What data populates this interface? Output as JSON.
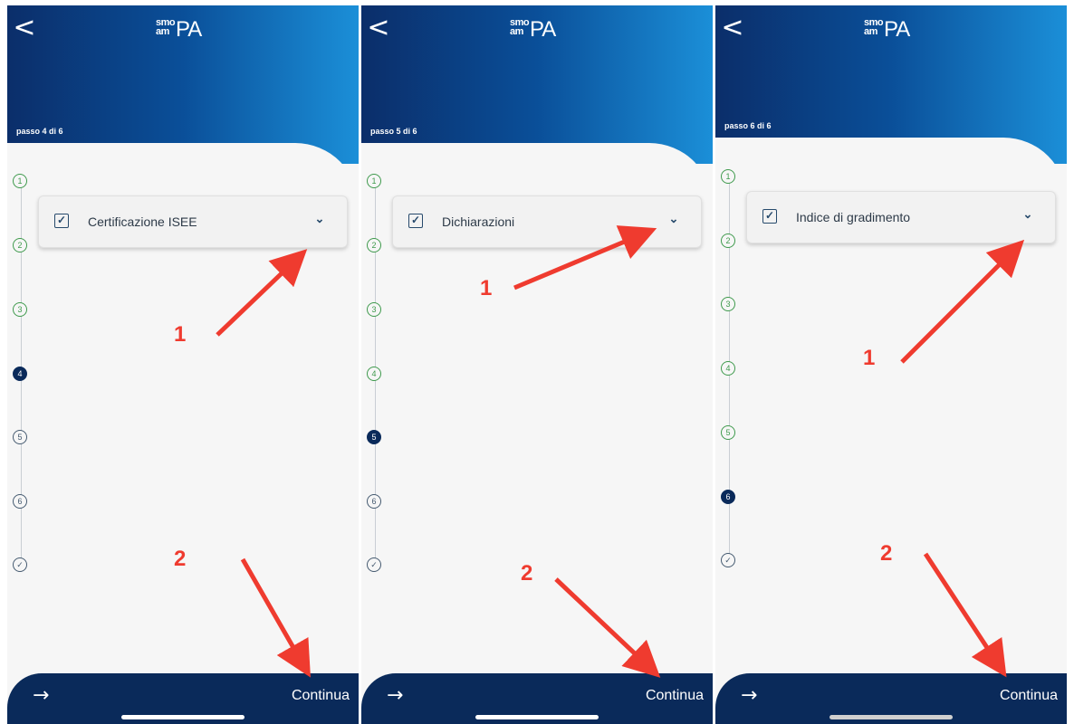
{
  "app": {
    "logo_small_top": "smo",
    "logo_small_bottom": "am",
    "logo_big": "PA"
  },
  "colors": {
    "header_from": "#0b2e6a",
    "header_to": "#1b8fd8",
    "done": "#3f9a4d",
    "active": "#0a2a5a",
    "annotation": "#ef3b2f"
  },
  "icons": {
    "back": "chevron-left-icon",
    "checkbox": "checkbox-checked-icon",
    "expand": "chevron-down-icon",
    "next": "arrow-right-icon",
    "step_done": "check-icon"
  },
  "screens": [
    {
      "back": "<",
      "step_label": "passo 4 di 6",
      "card_title": "Certificazione ISEE",
      "current_step": 4,
      "continue_label": "Continua",
      "next_arrow": "→",
      "steps": [
        "1",
        "2",
        "3",
        "4",
        "5",
        "6",
        "✓"
      ],
      "annotation_1": "1",
      "annotation_2": "2"
    },
    {
      "back": "<",
      "step_label": "passo 5 di 6",
      "card_title": "Dichiarazioni",
      "current_step": 5,
      "continue_label": "Continua",
      "next_arrow": "→",
      "steps": [
        "1",
        "2",
        "3",
        "4",
        "5",
        "6",
        "✓"
      ],
      "annotation_1": "1",
      "annotation_2": "2"
    },
    {
      "back": "<",
      "step_label": "passo 6 di 6",
      "card_title": "Indice di gradimento",
      "current_step": 6,
      "continue_label": "Continua",
      "next_arrow": "→",
      "steps": [
        "1",
        "2",
        "3",
        "4",
        "5",
        "6",
        "✓"
      ],
      "annotation_1": "1",
      "annotation_2": "2"
    }
  ]
}
